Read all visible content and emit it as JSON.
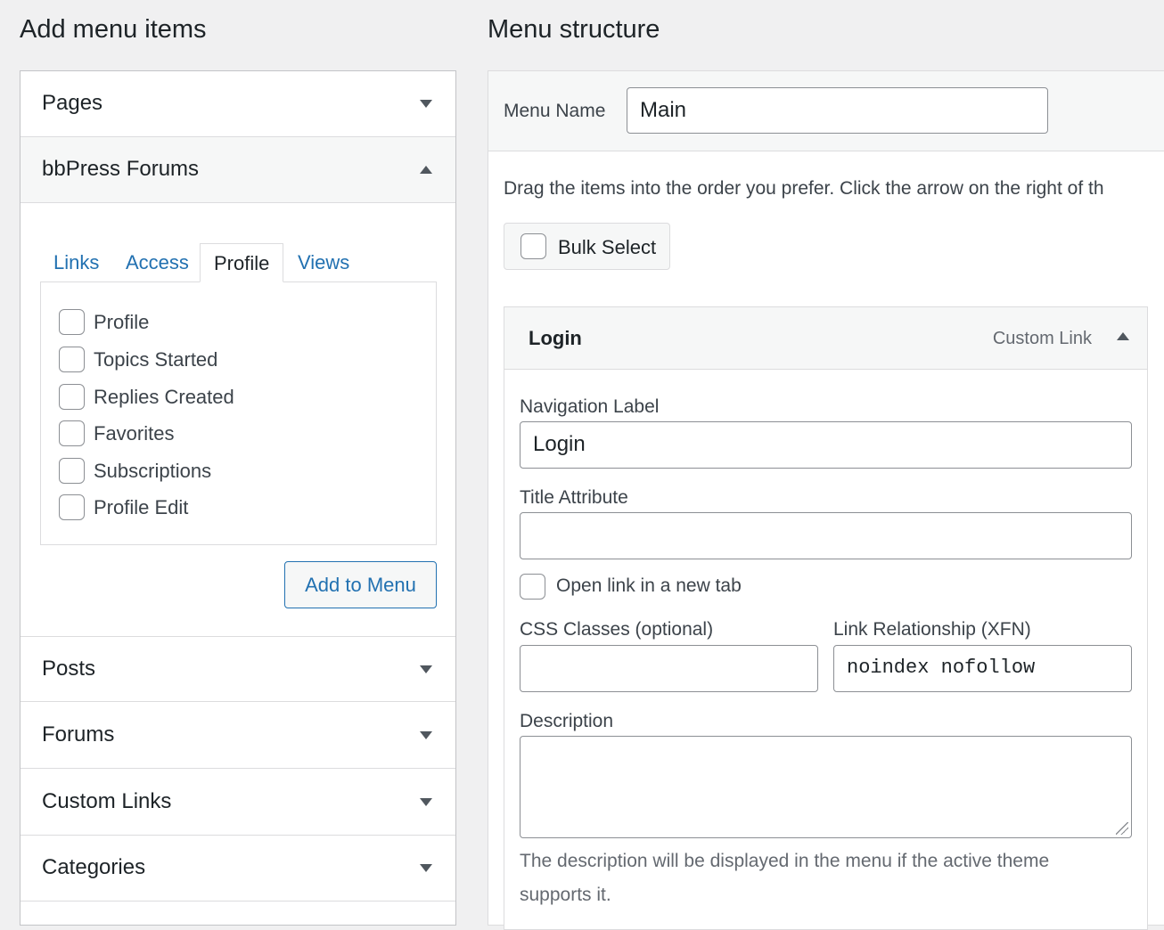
{
  "add_menu_items": {
    "title": "Add menu items",
    "sections": {
      "pages": "Pages",
      "bbpress": "bbPress Forums",
      "posts": "Posts",
      "forums": "Forums",
      "custom_links": "Custom Links",
      "categories": "Categories"
    },
    "tabs": {
      "links": "Links",
      "access": "Access",
      "profile": "Profile",
      "views": "Views"
    },
    "profile_items": [
      "Profile",
      "Topics Started",
      "Replies Created",
      "Favorites",
      "Subscriptions",
      "Profile Edit"
    ],
    "add_button": "Add to Menu"
  },
  "menu_structure": {
    "title": "Menu structure",
    "menu_name_label": "Menu Name",
    "menu_name_value": "Main",
    "drag_hint": "Drag the items into the order you prefer. Click the arrow on the right of th",
    "bulk_select": "Bulk Select",
    "item": {
      "title": "Login",
      "type": "Custom Link",
      "nav_label_label": "Navigation Label",
      "nav_label_value": "Login",
      "title_attr_label": "Title Attribute",
      "title_attr_value": "",
      "new_tab_label": "Open link in a new tab",
      "css_classes_label": "CSS Classes (optional)",
      "css_classes_value": "",
      "xfn_label": "Link Relationship (XFN)",
      "xfn_value": "noindex nofollow",
      "description_label": "Description",
      "description_value": "",
      "description_help": "The description will be displayed in the menu if the active theme supports it."
    }
  },
  "colors": {
    "link": "#2271b1",
    "background": "#f0f0f1",
    "border": "#dcdcde"
  }
}
